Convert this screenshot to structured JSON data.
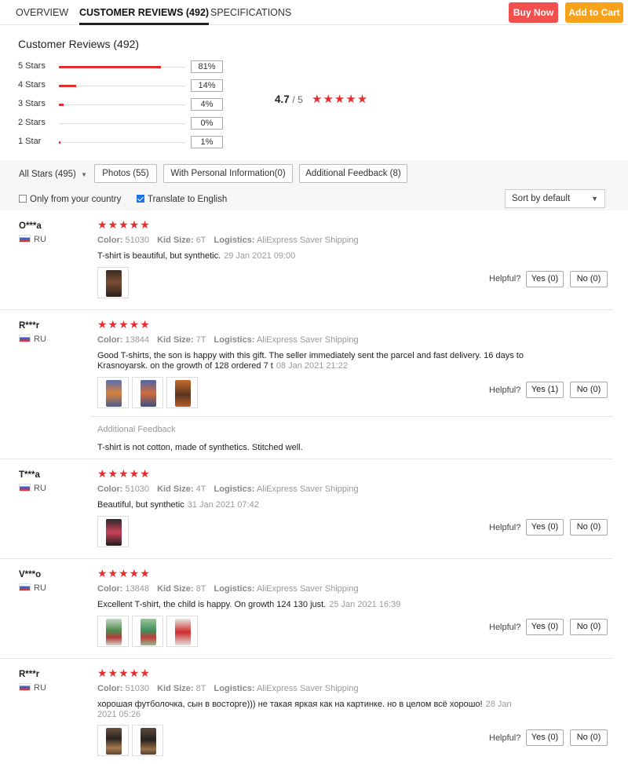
{
  "tabs": [
    {
      "label": "OVERVIEW"
    },
    {
      "label": "CUSTOMER REVIEWS (492)"
    },
    {
      "label": "SPECIFICATIONS"
    }
  ],
  "actions": {
    "buy_now": "Buy Now",
    "add_to_cart": "Add to Cart"
  },
  "summary": {
    "title": "Customer Reviews (492)",
    "distribution": [
      {
        "label": "5 Stars",
        "pct": "81%",
        "fraction": 0.81
      },
      {
        "label": "4 Stars",
        "pct": "14%",
        "fraction": 0.14
      },
      {
        "label": "3 Stars",
        "pct": "4%",
        "fraction": 0.04
      },
      {
        "label": "2 Stars",
        "pct": "0%",
        "fraction": 0.0
      },
      {
        "label": "1 Star",
        "pct": "1%",
        "fraction": 0.01
      }
    ],
    "average": "4.7",
    "out_of": "/ 5",
    "stars": "★★★★★"
  },
  "filters": {
    "all_stars": "All Stars (495)",
    "photos": "Photos (55)",
    "personal_info": "With Personal Information(0)",
    "additional_feedback": "Additional Feedback (8)",
    "only_country": "Only from your country",
    "translate": "Translate to English",
    "sort": "Sort by default"
  },
  "colors": {
    "accent_red": "#e62e2e",
    "buy_now": "#f24f4f",
    "add_to_cart": "#f7a21b",
    "checkbox": "#1a73e8"
  },
  "labels": {
    "color": "Color:",
    "kid_size": "Kid Size:",
    "logistics": "Logistics:",
    "helpful": "Helpful?",
    "additional_feedback": "Additional Feedback"
  },
  "reviews": [
    {
      "name": "O***a",
      "country": "RU",
      "stars": "★★★★★",
      "color": "51030",
      "size": "6T",
      "logistics": "AliExpress Saver Shipping",
      "text": "T-shirt is beautiful, but synthetic.",
      "date": "29 Jan 2021 09:00",
      "yes": "Yes (0)",
      "no": "No (0)"
    },
    {
      "name": "R***r",
      "country": "RU",
      "stars": "★★★★★",
      "color": "13844",
      "size": "7T",
      "logistics": "AliExpress Saver Shipping",
      "text": "Good T-shirts, the son is happy with this gift. The seller immediately sent the parcel and fast delivery. 16 days to Krasnoyarsk. on the growth of 128 ordered 7 t",
      "date": "08 Jan 2021 21:22",
      "yes": "Yes (1)",
      "no": "No (0)",
      "additional_feedback": "T-shirt is not cotton, made of synthetics. Stitched well."
    },
    {
      "name": "T***a",
      "country": "RU",
      "stars": "★★★★★",
      "color": "51030",
      "size": "4T",
      "logistics": "AliExpress Saver Shipping",
      "text": "Beautiful, but synthetic",
      "date": "31 Jan 2021 07:42",
      "yes": "Yes (0)",
      "no": "No (0)"
    },
    {
      "name": "V***o",
      "country": "RU",
      "stars": "★★★★★",
      "color": "13848",
      "size": "8T",
      "logistics": "AliExpress Saver Shipping",
      "text": "Excellent T-shirt, the child is happy. On growth 124 130 just.",
      "date": "25 Jan 2021 16:39",
      "yes": "Yes (0)",
      "no": "No (0)"
    },
    {
      "name": "R***r",
      "country": "RU",
      "stars": "★★★★★",
      "color": "51030",
      "size": "8T",
      "logistics": "AliExpress Saver Shipping",
      "text": "хорошая футболочка, сын в восторге))) не такая яркая как на картинке. но в целом всё хорошо!",
      "date": "28 Jan 2021 05:26",
      "yes": "Yes (0)",
      "no": "No (0)"
    }
  ]
}
